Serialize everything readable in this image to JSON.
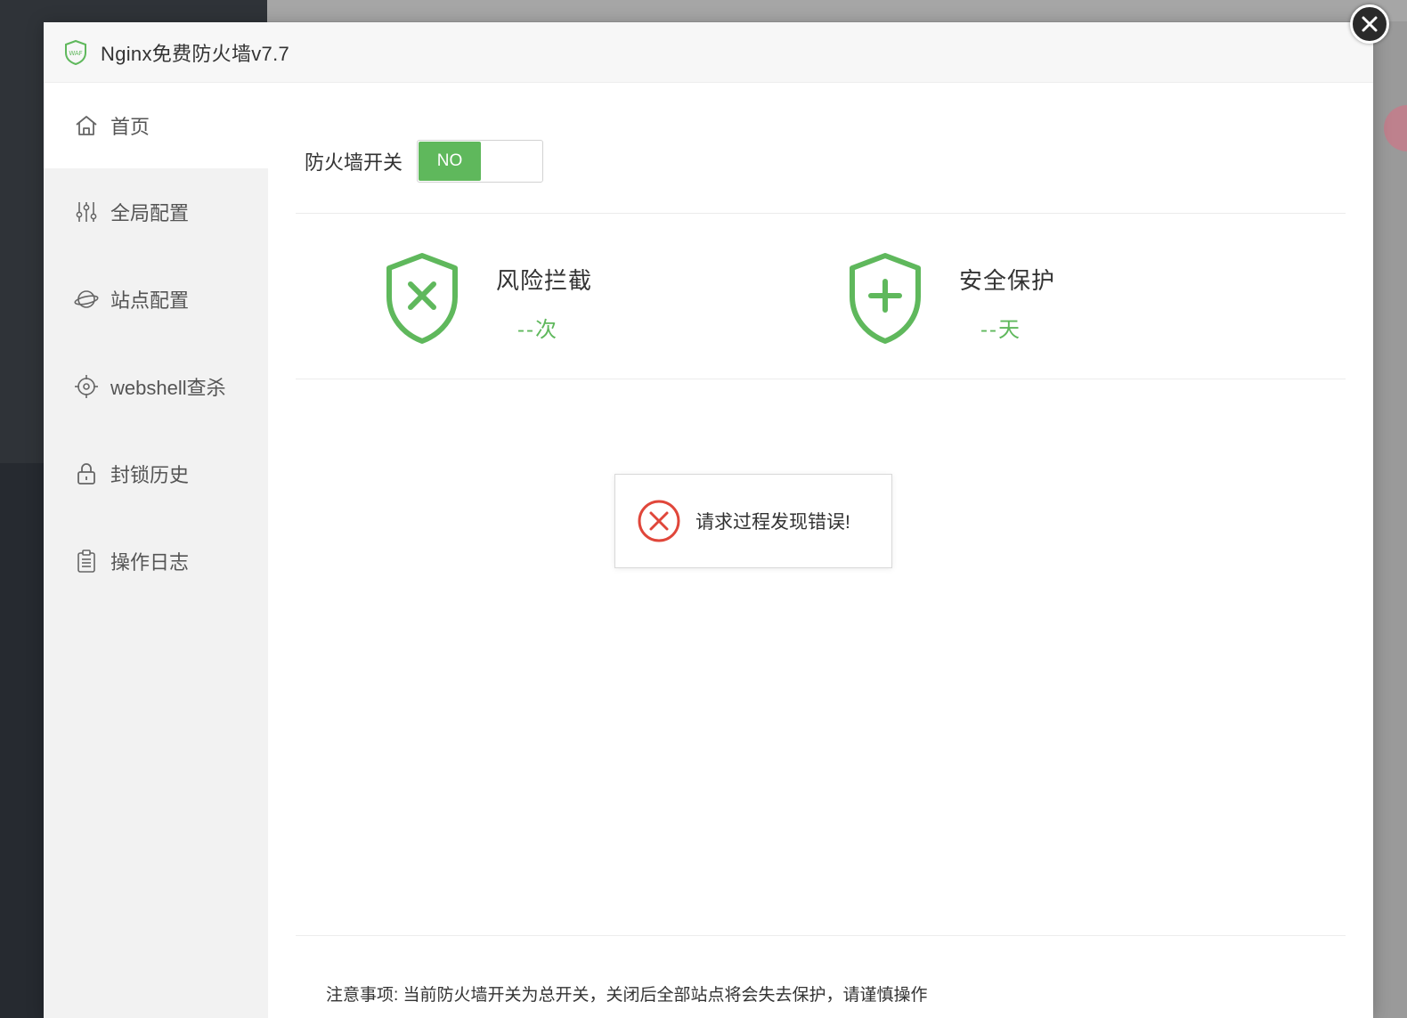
{
  "window": {
    "title": "Nginx免费防火墙v7.7",
    "logo_text": "WAF"
  },
  "sidebar": {
    "items": [
      {
        "label": "首页",
        "icon": "home-icon",
        "active": true
      },
      {
        "label": "全局配置",
        "icon": "sliders-icon",
        "active": false
      },
      {
        "label": "站点配置",
        "icon": "planet-icon",
        "active": false
      },
      {
        "label": "webshell查杀",
        "icon": "target-icon",
        "active": false
      },
      {
        "label": "封锁历史",
        "icon": "lock-icon",
        "active": false
      },
      {
        "label": "操作日志",
        "icon": "clipboard-icon",
        "active": false
      }
    ]
  },
  "firewall": {
    "switch_label": "防火墙开关",
    "switch_state_text": "NO"
  },
  "stats": {
    "risk": {
      "title": "风险拦截",
      "value": "--次",
      "icon": "shield-x-icon"
    },
    "safe": {
      "title": "安全保护",
      "value": "--天",
      "icon": "shield-plus-icon"
    }
  },
  "toast": {
    "message": "请求过程发现错误!",
    "icon": "error-circle-icon"
  },
  "notice": {
    "text": "注意事项: 当前防火墙开关为总开关，关闭后全部站点将会失去保护，请谨慎操作"
  },
  "colors": {
    "accent_green": "#5fb85c",
    "error_red": "#e0463a"
  }
}
